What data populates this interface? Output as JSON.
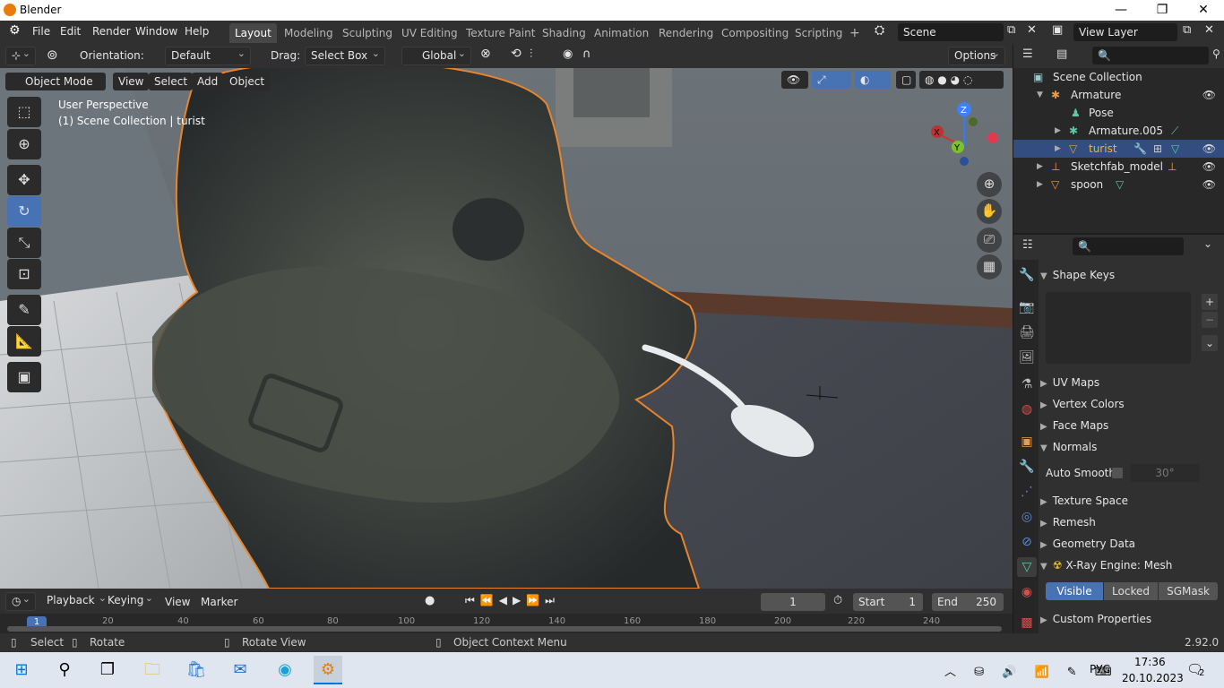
{
  "window": {
    "title": "Blender",
    "minimize": "—",
    "maximize": "❐",
    "close": "✕"
  },
  "menu": [
    "File",
    "Edit",
    "Render",
    "Window",
    "Help"
  ],
  "workspaces": [
    "Layout",
    "Modeling",
    "Sculpting",
    "UV Editing",
    "Texture Paint",
    "Shading",
    "Animation",
    "Rendering",
    "Compositing",
    "Scripting"
  ],
  "add_workspace": "+",
  "scene": {
    "name": "Scene"
  },
  "view_layer": {
    "name": "View Layer"
  },
  "header": {
    "orientation_label": "Orientation:",
    "orientation_value": "Default",
    "drag_label": "Drag:",
    "drag_value": "Select Box",
    "transform_space": "Global",
    "options": "Options"
  },
  "viewport": {
    "mode": "Object Mode",
    "menus": [
      "View",
      "Select",
      "Add",
      "Object"
    ],
    "perspective": "User Perspective",
    "collection_info": "(1) Scene Collection | turist",
    "gizmo": {
      "x": "X",
      "y": "Y",
      "z": "Z"
    }
  },
  "outliner": {
    "root": "Scene Collection",
    "items": [
      {
        "label": "Armature",
        "depth": 1,
        "selected": false
      },
      {
        "label": "Pose",
        "depth": 2,
        "selected": false
      },
      {
        "label": "Armature.005",
        "depth": 2,
        "selected": false
      },
      {
        "label": "turist",
        "depth": 2,
        "selected": true
      },
      {
        "label": "Sketchfab_model",
        "depth": 1,
        "selected": false
      },
      {
        "label": "spoon",
        "depth": 1,
        "selected": false
      }
    ]
  },
  "properties": {
    "sections": [
      "Shape Keys",
      "UV Maps",
      "Vertex Colors",
      "Face Maps",
      "Normals",
      "Texture Space",
      "Remesh",
      "Geometry Data",
      "X-Ray Engine: Mesh",
      "Custom Properties"
    ],
    "auto_smooth_label": "Auto Smooth",
    "auto_smooth_angle": "30°",
    "xray_buttons": [
      "Visible",
      "Locked",
      "SGMask"
    ]
  },
  "timeline": {
    "menus": [
      "Playback",
      "Keying",
      "View",
      "Marker"
    ],
    "current_frame": "1",
    "start_label": "Start",
    "start": "1",
    "end_label": "End",
    "end": "250",
    "ticks": [
      "1",
      "20",
      "40",
      "60",
      "80",
      "100",
      "120",
      "140",
      "160",
      "180",
      "200",
      "220",
      "240"
    ]
  },
  "status": {
    "select": "Select",
    "rotate": "Rotate",
    "rotate_view": "Rotate View",
    "context_menu": "Object Context Menu",
    "version": "2.92.0"
  },
  "taskbar": {
    "time": "17:36",
    "date": "20.10.2023",
    "lang": "РУС",
    "notifications": "2"
  }
}
